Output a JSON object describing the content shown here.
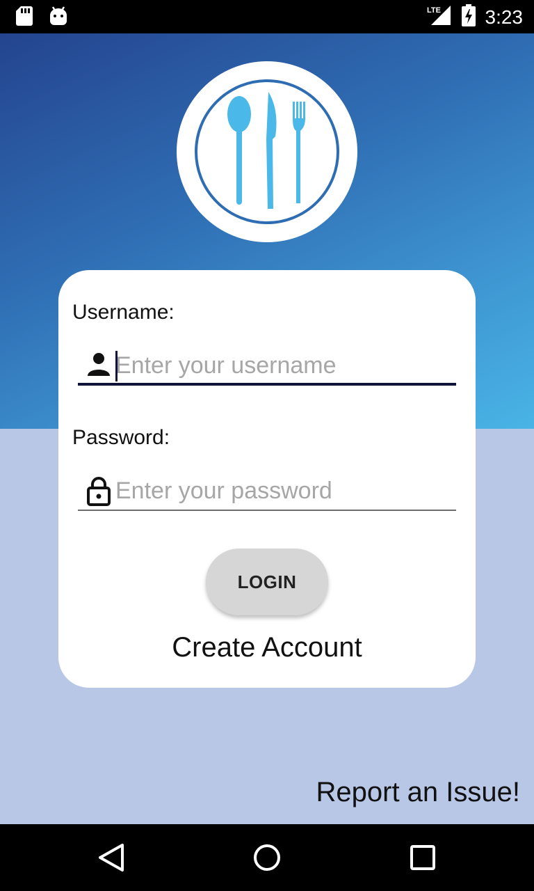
{
  "status_bar": {
    "time": "3:23",
    "network": "LTE",
    "icons": [
      "sd-card-icon",
      "android-icon",
      "signal-icon",
      "battery-charging-icon"
    ]
  },
  "logo": {
    "icon": "plate-cutlery-icon",
    "colors": {
      "ring": "#2f6db3",
      "cutlery": "#4bb8ea"
    }
  },
  "login_form": {
    "username_label": "Username:",
    "username_placeholder": "Enter your username",
    "username_value": "",
    "username_icon": "person-icon",
    "password_label": "Password:",
    "password_placeholder": "Enter your password",
    "password_value": "",
    "password_icon": "lock-icon",
    "login_button": "LOGIN",
    "create_account": "Create Account"
  },
  "footer": {
    "report_issue": "Report an Issue!"
  },
  "nav_bar": {
    "icons": [
      "back-icon",
      "home-icon",
      "recents-icon"
    ]
  },
  "colors": {
    "gradient_start": "#24448f",
    "gradient_end": "#49b4e6",
    "background": "#b8c7e6",
    "card": "#ffffff",
    "button": "#d6d6d6"
  }
}
